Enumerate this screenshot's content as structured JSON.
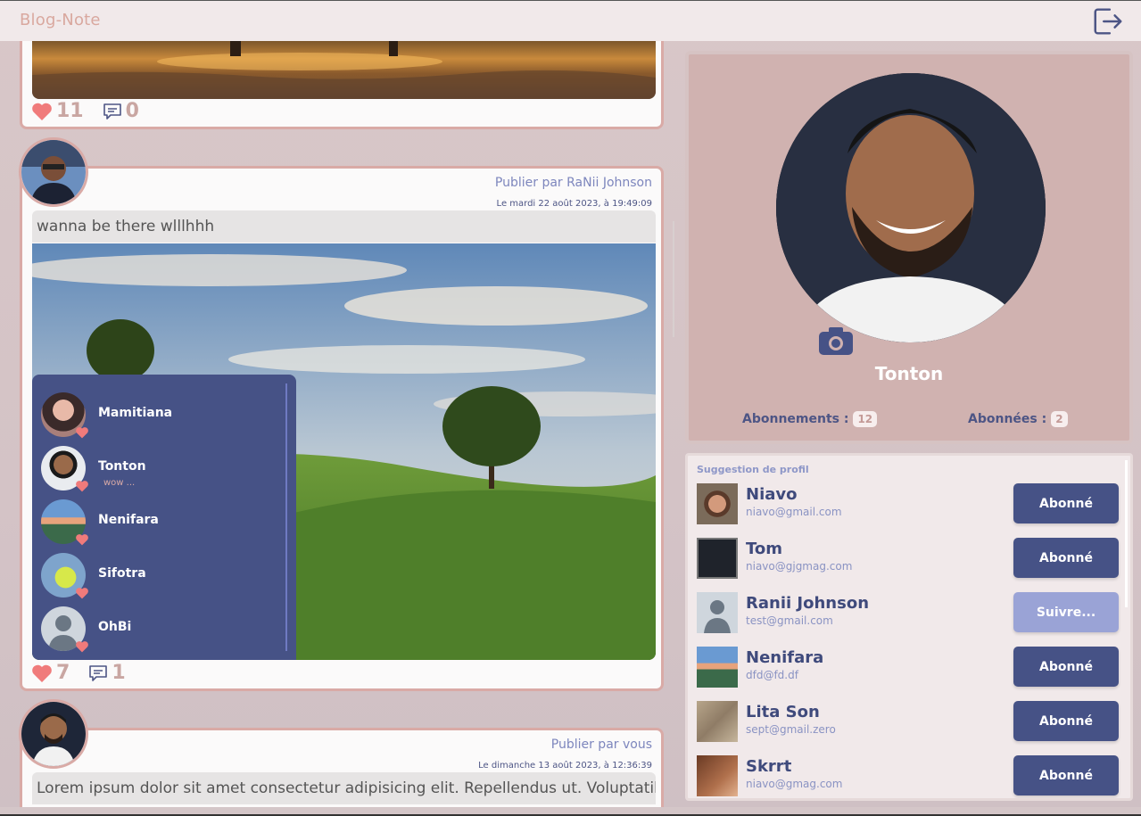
{
  "app": {
    "brand": "Blog-Note"
  },
  "posts": [
    {
      "likes": "11",
      "comments": "0"
    },
    {
      "author": "Publier par RaNii Johnson",
      "date": "Le mardi 22 août 2023, à 19:49:09",
      "caption": "wanna be there wlllhhh",
      "likes": "7",
      "comments": "1",
      "likers": [
        {
          "name": "Mamitiana",
          "sub": ""
        },
        {
          "name": "Tonton",
          "sub": "wow ..."
        },
        {
          "name": "Nenifara",
          "sub": ""
        },
        {
          "name": "Sifotra",
          "sub": ""
        },
        {
          "name": "OhBi",
          "sub": ""
        }
      ]
    },
    {
      "author": "Publier par vous",
      "date": "Le dimanche 13 août 2023, à 12:36:39",
      "caption": "Lorem ipsum dolor sit amet consectetur adipisicing elit. Repellendus ut. Voluptatibus"
    }
  ],
  "profile": {
    "name": "Tonton",
    "following_label": "Abonnements :",
    "following_count": "12",
    "followers_label": "Abonnées :",
    "followers_count": "2"
  },
  "suggestions": {
    "title": "Suggestion de profil",
    "items": [
      {
        "name": "Niavo",
        "email": "niavo@gmail.com",
        "button": "Abonné"
      },
      {
        "name": "Tom",
        "email": "niavo@gjgmag.com",
        "button": "Abonné"
      },
      {
        "name": "Ranii Johnson",
        "email": "test@gmail.com",
        "button": "Suivre..."
      },
      {
        "name": "Nenifara",
        "email": "dfd@fd.df",
        "button": "Abonné"
      },
      {
        "name": "Lita Son",
        "email": "sept@gmail.zero",
        "button": "Abonné"
      },
      {
        "name": "Skrrt",
        "email": "niavo@gmag.com",
        "button": "Abonné"
      }
    ]
  },
  "colors": {
    "brand": "#d9a89f",
    "accent": "#465286",
    "heart": "#f07b7b",
    "border": "#d9aaa6"
  }
}
